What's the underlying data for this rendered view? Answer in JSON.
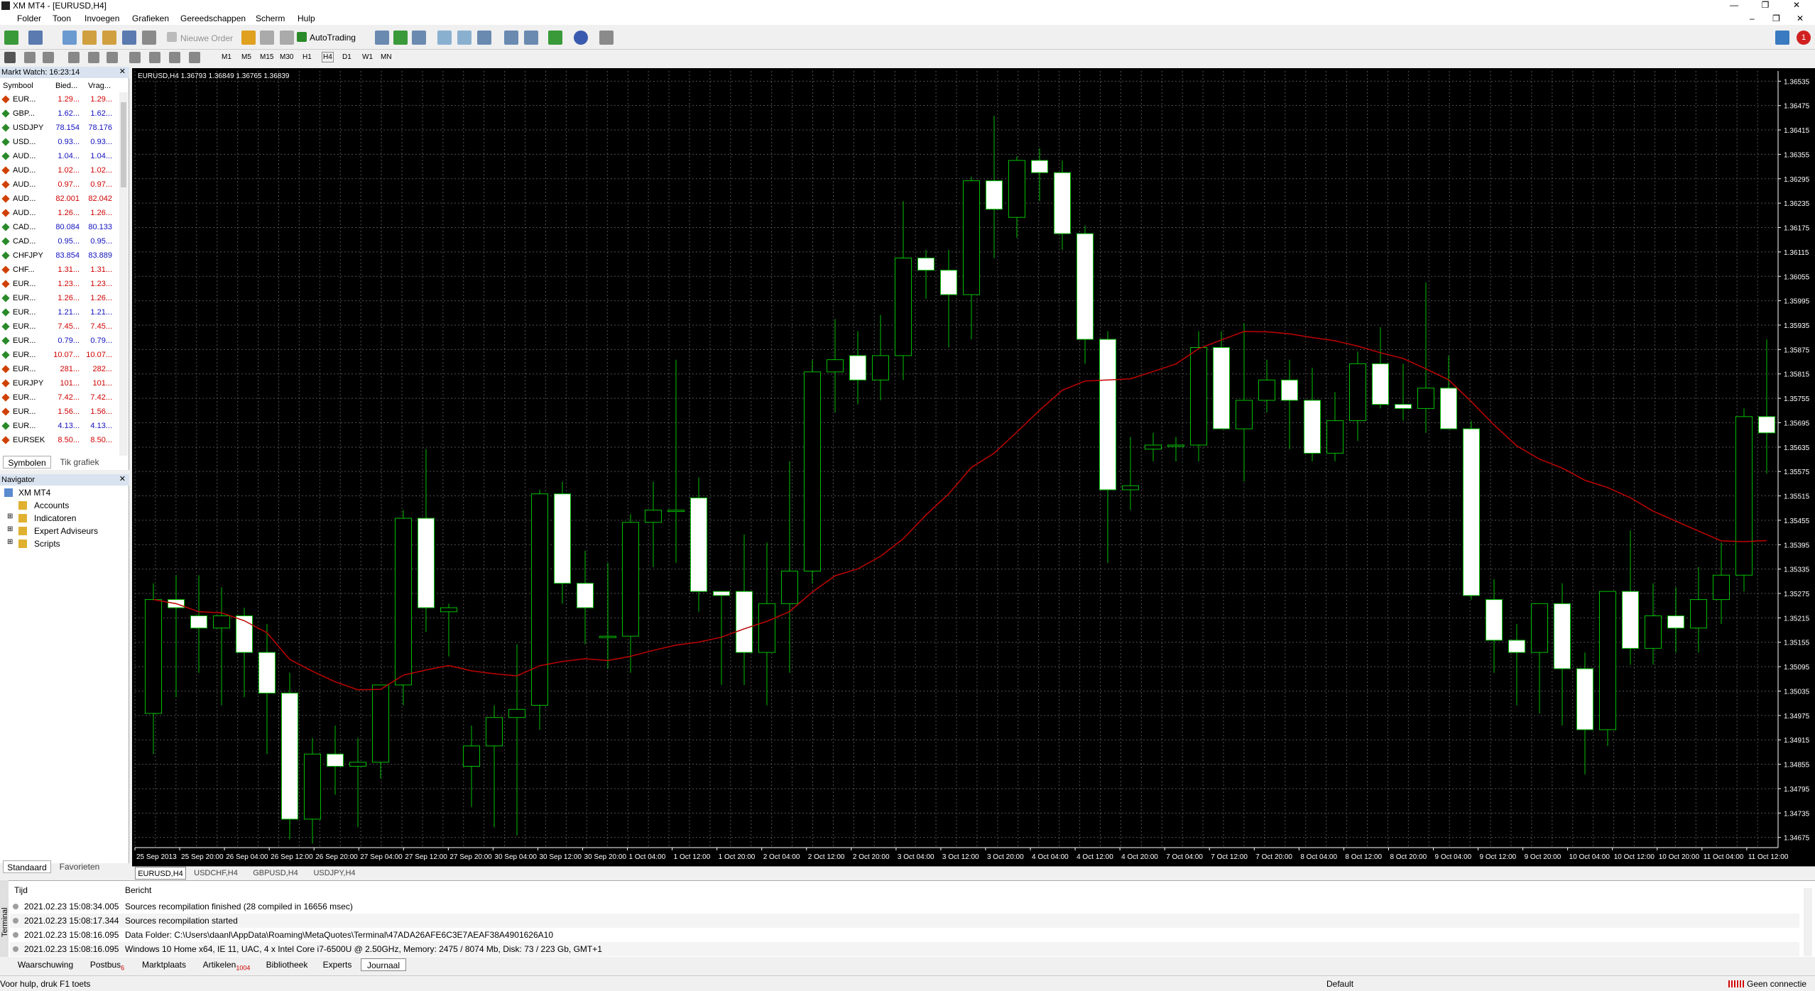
{
  "app": {
    "title": "XM MT4 - [EURUSD,H4]"
  },
  "window_buttons": [
    "—",
    "❐",
    "✕"
  ],
  "menu": [
    "Folder",
    "Toon",
    "Invoegen",
    "Grafieken",
    "Gereedschappen",
    "Scherm",
    "Hulp"
  ],
  "toolbar": {
    "new_order": "Nieuwe Order",
    "autotrading": "AutoTrading",
    "notify_count": "1",
    "timeframes": [
      "M1",
      "M5",
      "M15",
      "M30",
      "H1",
      "H4",
      "D1",
      "W1",
      "MN"
    ]
  },
  "market_watch": {
    "title": "Markt Watch: 16:23:14",
    "columns": [
      "Symbool",
      "Bied...",
      "Vrag..."
    ],
    "rows": [
      {
        "sym": "EUR...",
        "bid": "1.29...",
        "ask": "1.29...",
        "color": "#d00000",
        "dot": "#d04000"
      },
      {
        "sym": "GBP...",
        "bid": "1.62...",
        "ask": "1.62...",
        "color": "#1010c0",
        "dot": "#2a8a2a"
      },
      {
        "sym": "USDJPY",
        "bid": "78.154",
        "ask": "78.176",
        "color": "#1010c0",
        "dot": "#2a8a2a"
      },
      {
        "sym": "USD...",
        "bid": "0.93...",
        "ask": "0.93...",
        "color": "#1010c0",
        "dot": "#2a8a2a"
      },
      {
        "sym": "AUD...",
        "bid": "1.04...",
        "ask": "1.04...",
        "color": "#1010c0",
        "dot": "#2a8a2a"
      },
      {
        "sym": "AUD...",
        "bid": "1.02...",
        "ask": "1.02...",
        "color": "#d00000",
        "dot": "#d04000"
      },
      {
        "sym": "AUD...",
        "bid": "0.97...",
        "ask": "0.97...",
        "color": "#d00000",
        "dot": "#d04000"
      },
      {
        "sym": "AUD...",
        "bid": "82.001",
        "ask": "82.042",
        "color": "#d00000",
        "dot": "#d04000"
      },
      {
        "sym": "AUD...",
        "bid": "1.26...",
        "ask": "1.26...",
        "color": "#d00000",
        "dot": "#d04000"
      },
      {
        "sym": "CAD...",
        "bid": "80.084",
        "ask": "80.133",
        "color": "#1010c0",
        "dot": "#2a8a2a"
      },
      {
        "sym": "CAD...",
        "bid": "0.95...",
        "ask": "0.95...",
        "color": "#1010c0",
        "dot": "#2a8a2a"
      },
      {
        "sym": "CHFJPY",
        "bid": "83.854",
        "ask": "83.889",
        "color": "#1010c0",
        "dot": "#2a8a2a"
      },
      {
        "sym": "CHF...",
        "bid": "1.31...",
        "ask": "1.31...",
        "color": "#d00000",
        "dot": "#d04000"
      },
      {
        "sym": "EUR...",
        "bid": "1.23...",
        "ask": "1.23...",
        "color": "#d00000",
        "dot": "#d04000"
      },
      {
        "sym": "EUR...",
        "bid": "1.26...",
        "ask": "1.26...",
        "color": "#d00000",
        "dot": "#2a8a2a"
      },
      {
        "sym": "EUR...",
        "bid": "1.21...",
        "ask": "1.21...",
        "color": "#1010c0",
        "dot": "#2a8a2a"
      },
      {
        "sym": "EUR...",
        "bid": "7.45...",
        "ask": "7.45...",
        "color": "#d00000",
        "dot": "#2a8a2a"
      },
      {
        "sym": "EUR...",
        "bid": "0.79...",
        "ask": "0.79...",
        "color": "#1010c0",
        "dot": "#2a8a2a"
      },
      {
        "sym": "EUR...",
        "bid": "10.07...",
        "ask": "10.07...",
        "color": "#d00000",
        "dot": "#2a8a2a"
      },
      {
        "sym": "EUR...",
        "bid": "281...",
        "ask": "282...",
        "color": "#d00000",
        "dot": "#d04000"
      },
      {
        "sym": "EURJPY",
        "bid": "101...",
        "ask": "101...",
        "color": "#d00000",
        "dot": "#d04000"
      },
      {
        "sym": "EUR...",
        "bid": "7.42...",
        "ask": "7.42...",
        "color": "#d00000",
        "dot": "#d04000"
      },
      {
        "sym": "EUR...",
        "bid": "1.56...",
        "ask": "1.56...",
        "color": "#d00000",
        "dot": "#d04000"
      },
      {
        "sym": "EUR...",
        "bid": "4.13...",
        "ask": "4.13...",
        "color": "#1010c0",
        "dot": "#2a8a2a"
      },
      {
        "sym": "EURSEK",
        "bid": "8.50...",
        "ask": "8.50...",
        "color": "#d00000",
        "dot": "#d04000"
      }
    ],
    "tabs": [
      "Symbolen",
      "Tik grafiek"
    ]
  },
  "navigator": {
    "title": "Navigator",
    "root": "XM MT4",
    "items": [
      "Accounts",
      "Indicatoren",
      "Expert Adviseurs",
      "Scripts"
    ],
    "tabs": [
      "Standaard",
      "Favorieten"
    ]
  },
  "chart_data": {
    "type": "candlestick",
    "symbol_label": "EURUSD,H4  1.36793 1.36849 1.36765 1.36839",
    "ylim": [
      1.3465,
      1.3656
    ],
    "y_ticks": [
      "1.36535",
      "1.36475",
      "1.36415",
      "1.36355",
      "1.36295",
      "1.36235",
      "1.36175",
      "1.36115",
      "1.36055",
      "1.35995",
      "1.35935",
      "1.35875",
      "1.35815",
      "1.35755",
      "1.35695",
      "1.35635",
      "1.35575",
      "1.35515",
      "1.35455",
      "1.35395",
      "1.35335",
      "1.35275",
      "1.35215",
      "1.35155",
      "1.35095",
      "1.35035",
      "1.34975",
      "1.34915",
      "1.34855",
      "1.34795",
      "1.34735",
      "1.34675"
    ],
    "x_ticks": [
      "25 Sep 2013",
      "25 Sep 20:00",
      "26 Sep 04:00",
      "26 Sep 12:00",
      "26 Sep 20:00",
      "27 Sep 04:00",
      "27 Sep 12:00",
      "27 Sep 20:00",
      "30 Sep 04:00",
      "30 Sep 12:00",
      "30 Sep 20:00",
      "1 Oct 04:00",
      "1 Oct 12:00",
      "1 Oct 20:00",
      "2 Oct 04:00",
      "2 Oct 12:00",
      "2 Oct 20:00",
      "3 Oct 04:00",
      "3 Oct 12:00",
      "3 Oct 20:00",
      "4 Oct 04:00",
      "4 Oct 12:00",
      "4 Oct 20:00",
      "7 Oct 04:00",
      "7 Oct 12:00",
      "7 Oct 20:00",
      "8 Oct 04:00",
      "8 Oct 12:00",
      "8 Oct 20:00",
      "9 Oct 04:00",
      "9 Oct 12:00",
      "9 Oct 20:00",
      "10 Oct 04:00",
      "10 Oct 12:00",
      "10 Oct 20:00",
      "11 Oct 04:00",
      "11 Oct 12:00"
    ],
    "candles": [
      [
        1.3498,
        1.353,
        1.3488,
        1.3526
      ],
      [
        1.3526,
        1.3532,
        1.3502,
        1.3524
      ],
      [
        1.3522,
        1.3532,
        1.3508,
        1.3519
      ],
      [
        1.3519,
        1.3529,
        1.35,
        1.3522
      ],
      [
        1.3522,
        1.3524,
        1.3502,
        1.3513
      ],
      [
        1.3513,
        1.352,
        1.3488,
        1.3503
      ],
      [
        1.3503,
        1.3508,
        1.3467,
        1.3472
      ],
      [
        1.3472,
        1.3492,
        1.3466,
        1.3488
      ],
      [
        1.3488,
        1.3495,
        1.3478,
        1.3485
      ],
      [
        1.3485,
        1.3492,
        1.347,
        1.3486
      ],
      [
        1.3486,
        1.3505,
        1.3482,
        1.3505
      ],
      [
        1.3505,
        1.3548,
        1.35,
        1.3546
      ],
      [
        1.3546,
        1.3563,
        1.3518,
        1.3524
      ],
      [
        1.3523,
        1.3525,
        1.3512,
        1.3524
      ],
      [
        1.3485,
        1.3495,
        1.3475,
        1.349
      ],
      [
        1.349,
        1.35,
        1.347,
        1.3497
      ],
      [
        1.3497,
        1.3515,
        1.3468,
        1.3499
      ],
      [
        1.35,
        1.3553,
        1.3494,
        1.3552
      ],
      [
        1.3552,
        1.3555,
        1.3525,
        1.353
      ],
      [
        1.353,
        1.3538,
        1.3515,
        1.3524
      ],
      [
        1.3517,
        1.3535,
        1.3509,
        1.3517
      ],
      [
        1.3517,
        1.3547,
        1.3508,
        1.3545
      ],
      [
        1.3545,
        1.3555,
        1.3534,
        1.3548
      ],
      [
        1.3548,
        1.3585,
        1.3535,
        1.3548
      ],
      [
        1.3551,
        1.3556,
        1.3523,
        1.3528
      ],
      [
        1.3528,
        1.3527,
        1.3505,
        1.3527
      ],
      [
        1.3528,
        1.3542,
        1.3505,
        1.3513
      ],
      [
        1.3513,
        1.354,
        1.35,
        1.3525
      ],
      [
        1.3525,
        1.356,
        1.3508,
        1.3533
      ],
      [
        1.3533,
        1.3585,
        1.353,
        1.3582
      ],
      [
        1.3582,
        1.3595,
        1.3572,
        1.3585
      ],
      [
        1.3586,
        1.3592,
        1.3574,
        1.358
      ],
      [
        1.358,
        1.3596,
        1.3575,
        1.3586
      ],
      [
        1.3586,
        1.3624,
        1.358,
        1.361
      ],
      [
        1.361,
        1.3612,
        1.36,
        1.3607
      ],
      [
        1.3607,
        1.3612,
        1.3588,
        1.3601
      ],
      [
        1.3601,
        1.363,
        1.359,
        1.3629
      ],
      [
        1.3629,
        1.3645,
        1.361,
        1.3622
      ],
      [
        1.362,
        1.3635,
        1.3615,
        1.3634
      ],
      [
        1.3634,
        1.3637,
        1.3624,
        1.3631
      ],
      [
        1.3631,
        1.3634,
        1.3612,
        1.3616
      ],
      [
        1.3616,
        1.3618,
        1.3584,
        1.359
      ],
      [
        1.359,
        1.3592,
        1.3535,
        1.3553
      ],
      [
        1.3553,
        1.3566,
        1.3548,
        1.3554
      ],
      [
        1.3563,
        1.3567,
        1.356,
        1.3564
      ],
      [
        1.3564,
        1.3566,
        1.356,
        1.3564
      ],
      [
        1.3564,
        1.3592,
        1.356,
        1.3588
      ],
      [
        1.3588,
        1.3592,
        1.3568,
        1.3568
      ],
      [
        1.3568,
        1.3594,
        1.3555,
        1.3575
      ],
      [
        1.3575,
        1.3585,
        1.3572,
        1.358
      ],
      [
        1.358,
        1.3585,
        1.3563,
        1.3575
      ],
      [
        1.3575,
        1.3583,
        1.356,
        1.3562
      ],
      [
        1.3562,
        1.3577,
        1.356,
        1.357
      ],
      [
        1.357,
        1.3587,
        1.3565,
        1.3584
      ],
      [
        1.3584,
        1.3593,
        1.3573,
        1.3574
      ],
      [
        1.3574,
        1.3584,
        1.357,
        1.3573
      ],
      [
        1.3573,
        1.3604,
        1.3567,
        1.3578
      ],
      [
        1.3578,
        1.3586,
        1.3568,
        1.3568
      ],
      [
        1.3568,
        1.357,
        1.3526,
        1.3527
      ],
      [
        1.3526,
        1.3531,
        1.3508,
        1.3516
      ],
      [
        1.3516,
        1.352,
        1.35,
        1.3513
      ],
      [
        1.3513,
        1.3525,
        1.3498,
        1.3525
      ],
      [
        1.3525,
        1.353,
        1.3495,
        1.3509
      ],
      [
        1.3509,
        1.3513,
        1.3483,
        1.3494
      ],
      [
        1.3494,
        1.3512,
        1.349,
        1.3528
      ],
      [
        1.3528,
        1.3543,
        1.351,
        1.3514
      ],
      [
        1.3514,
        1.353,
        1.351,
        1.3522
      ],
      [
        1.3522,
        1.3529,
        1.3513,
        1.3519
      ],
      [
        1.3519,
        1.3534,
        1.3513,
        1.3526
      ],
      [
        1.3526,
        1.354,
        1.352,
        1.3532
      ],
      [
        1.3532,
        1.3573,
        1.3528,
        1.3571
      ],
      [
        1.3571,
        1.359,
        1.3557,
        1.3567
      ]
    ],
    "ma_series_color": "#c00000",
    "candle_colors": {
      "up_body": "#000000",
      "down_body": "#ffffff",
      "wick": "#00c000",
      "grid": "#505050",
      "axis": "#ffffff"
    }
  },
  "chart_tabs": [
    "EURUSD,H4",
    "USDCHF,H4",
    "GBPUSD,H4",
    "USDJPY,H4"
  ],
  "terminal": {
    "side_label": "Terminal",
    "columns": [
      "Tijd",
      "Bericht"
    ],
    "rows": [
      {
        "t": "2021.02.23 15:08:34.005",
        "m": "Sources recompilation finished (28 compiled in 16656 msec)"
      },
      {
        "t": "2021.02.23 15:08:17.344",
        "m": "Sources recompilation started"
      },
      {
        "t": "2021.02.23 15:08:16.095",
        "m": "Data Folder: C:\\Users\\daanl\\AppData\\Roaming\\MetaQuotes\\Terminal\\47ADA26AFE6C3E7AEAF38A4901626A10"
      },
      {
        "t": "2021.02.23 15:08:16.095",
        "m": "Windows 10 Home x64, IE 11, UAC, 4 x Intel Core i7-6500U  @ 2.50GHz, Memory: 2475 / 8074 Mb, Disk: 73 / 223 Gb, GMT+1"
      }
    ],
    "tabs": [
      {
        "label": "Waarschuwing"
      },
      {
        "label": "Postbus",
        "badge": "6"
      },
      {
        "label": "Marktplaats"
      },
      {
        "label": "Artikelen",
        "badge": "1004"
      },
      {
        "label": "Bibliotheek"
      },
      {
        "label": "Experts"
      },
      {
        "label": "Journaal"
      }
    ]
  },
  "status": {
    "help": "Voor hulp, druk F1 toets",
    "profile": "Default",
    "connection": "Geen connectie"
  }
}
